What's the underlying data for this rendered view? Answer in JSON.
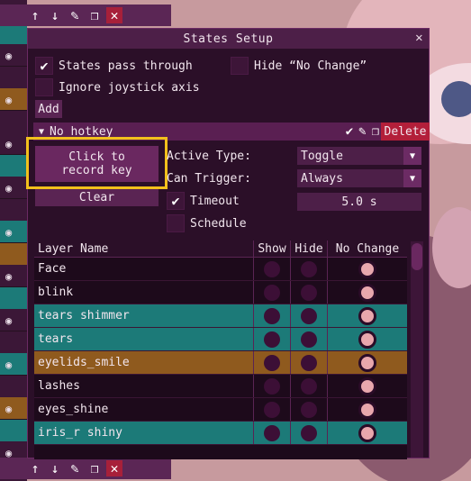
{
  "window": {
    "title": "States Setup",
    "close_glyph": "✕",
    "options": {
      "pass_through": {
        "label": "States pass through",
        "checked": true
      },
      "hide_no_change": {
        "label": "Hide “No Change”",
        "checked": false
      },
      "ignore_joystick": {
        "label": "Ignore joystick axis",
        "checked": false
      }
    },
    "add_label": "Add",
    "hotkey": {
      "header": "No hotkey",
      "delete_label": "Delete",
      "record_label": "Click to\nrecord key",
      "clear_label": "Clear",
      "active_type_label": "Active Type:",
      "active_type_value": "Toggle",
      "can_trigger_label": "Can Trigger:",
      "can_trigger_value": "Always",
      "timeout_label": "Timeout",
      "timeout_checked": true,
      "timeout_value": "5.0 s",
      "schedule_label": "Schedule",
      "schedule_checked": false
    },
    "table": {
      "headers": [
        "Layer Name",
        "Show",
        "Hide",
        "No Change"
      ],
      "rows": [
        {
          "name": "Face",
          "state": "No Change",
          "color": "#1d0a1b"
        },
        {
          "name": "blink",
          "state": "No Change",
          "color": "#1d0a1b"
        },
        {
          "name": "tears shimmer",
          "state": "No Change",
          "color": "#1c7a78"
        },
        {
          "name": "tears",
          "state": "No Change",
          "color": "#1c7a78"
        },
        {
          "name": "eyelids_smile",
          "state": "No Change",
          "color": "#8f5a1e"
        },
        {
          "name": "lashes",
          "state": "No Change",
          "color": "#1d0a1b"
        },
        {
          "name": "eyes_shine",
          "state": "No Change",
          "color": "#1d0a1b"
        },
        {
          "name": "iris_r shiny",
          "state": "No Change",
          "color": "#1c7a78"
        }
      ]
    }
  },
  "colors": {
    "highlight": "#f2c01c",
    "accent": "#5a2453",
    "delete": "#b31f3a"
  },
  "icons": {
    "check": "✔",
    "pencil": "✎",
    "copy": "❐",
    "arrow_up": "↑",
    "arrow_down": "↓",
    "close": "✕",
    "eye": "👁",
    "dropdown_arrow": "▼",
    "tri": "▼"
  }
}
